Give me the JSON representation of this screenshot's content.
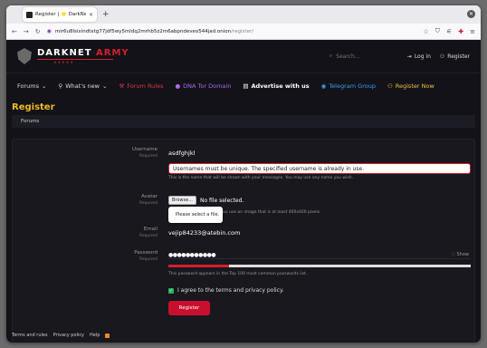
{
  "browser": {
    "tab_title": "Register | ⭐ DarkNet Ar",
    "new_tab": "+",
    "url_host": "mir6u8lsixindtxtg77jdf5wy5mldq2mrhb5z2m6abpndeveo544jad.onion",
    "url_path": "/register/"
  },
  "header": {
    "brand_part1": "DARKNET",
    "brand_part2": "ARMY",
    "stars": "★★★★★",
    "search_placeholder": "Search...",
    "login": "Log in",
    "register": "Register"
  },
  "nav": {
    "items": [
      {
        "label": "Forums"
      },
      {
        "label": "What's new"
      },
      {
        "label": "Forum Rules"
      },
      {
        "label": "DNA Tor Domain"
      },
      {
        "label": "Advertise with us"
      },
      {
        "label": "Telegram Group"
      },
      {
        "label": "Register Now"
      }
    ]
  },
  "page": {
    "title": "Register",
    "breadcrumb": "Forums"
  },
  "form": {
    "username_label": "Username",
    "required": "Required",
    "username_value": "asdfghjkl",
    "username_error": "Usernames must be unique. The specified username is already in use.",
    "username_hint": "This is the name that will be shown with your messages. You may use any name you wish.",
    "avatar_label": "Avatar",
    "browse": "Browse...",
    "no_file": "No file selected.",
    "avatar_hint": "ou use an image that is at least 400x400 pixels.",
    "tooltip": "Please select a file.",
    "email_label": "Email",
    "email_value": "vejip84233@atebin.com",
    "password_label": "Password",
    "password_value": "●●●●●●●●●●●",
    "show": "Show",
    "password_strength": 0.2,
    "password_hint": "This password appears in the Top 100 most common passwords list.",
    "agree": "I agree to the terms and privacy policy.",
    "submit": "Register"
  },
  "footer": {
    "items": [
      "Terms and rules",
      "Privacy policy",
      "Help"
    ]
  },
  "colors": {
    "accent_red": "#c8102e",
    "title_yellow": "#f2b824",
    "bg": "#121218"
  }
}
